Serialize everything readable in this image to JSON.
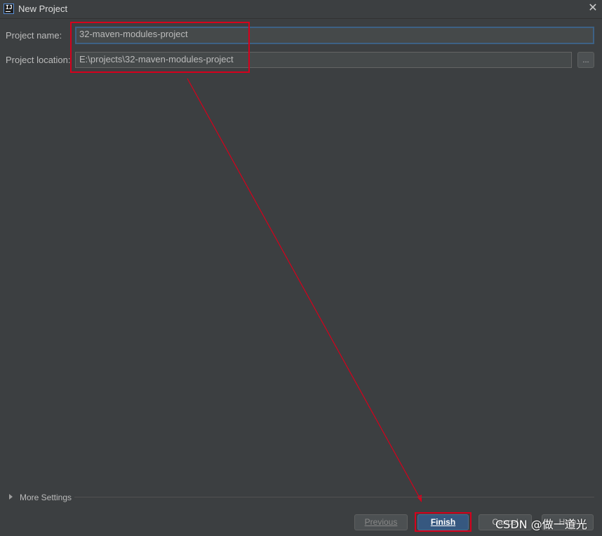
{
  "window": {
    "title": "New Project",
    "app_icon_text": "IJ",
    "close_symbol": "✕"
  },
  "form": {
    "project_name_label": "Project name:",
    "project_name_value": "32-maven-modules-project",
    "project_location_label": "Project location:",
    "project_location_value": "E:\\projects\\32-maven-modules-project",
    "browse_label": "..."
  },
  "more_settings": {
    "label": "More Settings",
    "expanded": false
  },
  "buttons": {
    "previous_label": "Previous",
    "finish_label": "Finish",
    "cancel_label": "Cancel",
    "help_label": "Help"
  },
  "watermark": "CSDN @做一道光",
  "colors": {
    "background": "#3c3f41",
    "field_background": "#45494a",
    "focus_border": "#3d6185",
    "primary_button": "#365880",
    "annotation_red": "#d6001c"
  },
  "icons": {
    "app": "intellij-idea-icon",
    "close": "close-icon",
    "expand": "triangle-right-icon"
  }
}
